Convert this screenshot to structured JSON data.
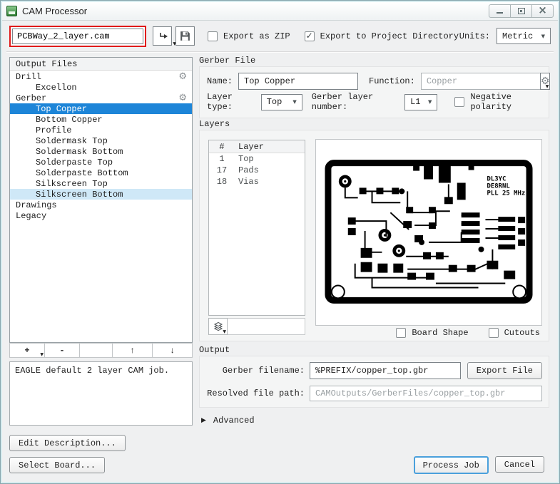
{
  "window": {
    "title": "CAM Processor"
  },
  "toolbar": {
    "filename": "PCBWay_2_layer.cam",
    "export_zip_label": "Export as ZIP",
    "export_dir_label": "Export to Project Directory",
    "units_label": "Units:",
    "units_value": "Metric"
  },
  "tree": {
    "header": "Output Files",
    "items": [
      {
        "label": "Drill",
        "level": 0,
        "gear": true,
        "state": ""
      },
      {
        "label": "Excellon",
        "level": 1,
        "gear": false,
        "state": ""
      },
      {
        "label": "Gerber",
        "level": 0,
        "gear": true,
        "state": ""
      },
      {
        "label": "Top Copper",
        "level": 1,
        "gear": false,
        "state": "selected"
      },
      {
        "label": "Bottom Copper",
        "level": 1,
        "gear": false,
        "state": ""
      },
      {
        "label": "Profile",
        "level": 1,
        "gear": false,
        "state": ""
      },
      {
        "label": "Soldermask Top",
        "level": 1,
        "gear": false,
        "state": ""
      },
      {
        "label": "Soldermask Bottom",
        "level": 1,
        "gear": false,
        "state": ""
      },
      {
        "label": "Solderpaste Top",
        "level": 1,
        "gear": false,
        "state": ""
      },
      {
        "label": "Solderpaste Bottom",
        "level": 1,
        "gear": false,
        "state": ""
      },
      {
        "label": "Silkscreen Top",
        "level": 1,
        "gear": false,
        "state": ""
      },
      {
        "label": "Silkscreen Bottom",
        "level": 1,
        "gear": false,
        "state": "hover"
      },
      {
        "label": "Drawings",
        "level": 0,
        "gear": false,
        "state": ""
      },
      {
        "label": "Legacy",
        "level": 0,
        "gear": false,
        "state": ""
      }
    ]
  },
  "list_toolbar": {
    "add": "+",
    "remove": "-",
    "move_up": "↑",
    "move_down": "↓"
  },
  "description": {
    "text": "EAGLE default 2 layer CAM job.",
    "edit_button": "Edit Description...",
    "select_board_button": "Select Board..."
  },
  "gerber_file": {
    "section_label": "Gerber File",
    "name_label": "Name:",
    "name_value": "Top Copper",
    "function_label": "Function:",
    "function_value": "Copper",
    "layer_type_label": "Layer type:",
    "layer_type_value": "Top",
    "layer_number_label": "Gerber layer number:",
    "layer_number_value": "L1",
    "negative_polarity_label": "Negative polarity"
  },
  "layers": {
    "section_label": "Layers",
    "table": {
      "headers": [
        "#",
        "Layer"
      ],
      "rows": [
        [
          "1",
          "Top"
        ],
        [
          "17",
          "Pads"
        ],
        [
          "18",
          "Vias"
        ]
      ]
    },
    "board_shape_label": "Board Shape",
    "cutouts_label": "Cutouts",
    "preview_text": [
      "DL3YC",
      "DE8RNL",
      "PLL 25 MHz"
    ]
  },
  "output": {
    "section_label": "Output",
    "filename_label": "Gerber filename:",
    "filename_value": "%PREFIX/copper_top.gbr",
    "export_button": "Export File",
    "resolved_label": "Resolved file path:",
    "resolved_value": "CAMOutputs/GerberFiles/copper_top.gbr",
    "advanced_label": "Advanced"
  },
  "actions": {
    "process_job": "Process Job",
    "cancel": "Cancel"
  },
  "icons": {
    "gear": "⚙",
    "dropdown_small": "▼",
    "check": "✓",
    "close": "×",
    "triangle_right": "▶"
  },
  "colors": {
    "selection_blue": "#1d85d8",
    "hover_row": "#cfe8f7",
    "annotation_red": "#e01a1a",
    "focus_button_border": "#4aa0dc"
  }
}
